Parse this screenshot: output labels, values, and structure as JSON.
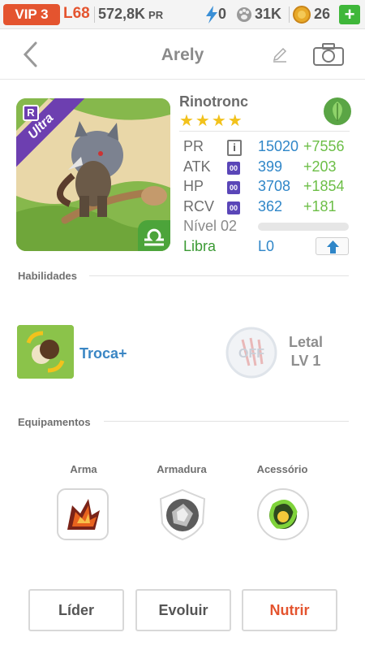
{
  "status_bar": {
    "vip": "VIP 3",
    "level": "L68",
    "power": "572,8K",
    "power_label": "PR",
    "energy": "0",
    "paws": "31K",
    "coins": "26",
    "add": "+"
  },
  "header": {
    "title": "Arely"
  },
  "creature": {
    "rarity": "Ultra",
    "rarity_badge": "R",
    "name": "Rinotronc",
    "stars": "★★★★",
    "element": "leaf-icon",
    "stats": [
      {
        "label": "PR",
        "icon": "i",
        "value": "15020",
        "bonus": "+7556"
      },
      {
        "label": "ATK",
        "icon": "00",
        "value": "399",
        "bonus": "+203"
      },
      {
        "label": "HP",
        "icon": "00",
        "value": "3708",
        "bonus": "+1854"
      },
      {
        "label": "RCV",
        "icon": "00",
        "value": "362",
        "bonus": "+181"
      }
    ],
    "level_label": "Nível 02",
    "sign": "Libra",
    "sign_level": "L0"
  },
  "skills": {
    "title": "Habilidades",
    "active_name": "Troca+",
    "passive_status": "OFF",
    "passive_name": "Letal",
    "passive_level": "LV 1"
  },
  "equipment": {
    "title": "Equipamentos",
    "slots": [
      {
        "label": "Arma"
      },
      {
        "label": "Armadura"
      },
      {
        "label": "Acessório"
      }
    ]
  },
  "actions": {
    "leader": "Líder",
    "evolve": "Evoluir",
    "feed": "Nutrir"
  },
  "colors": {
    "accent": "#e4542f",
    "stat_value": "#2f86c8",
    "stat_bonus": "#6cbe46",
    "rarity": "#6d3fb0"
  }
}
